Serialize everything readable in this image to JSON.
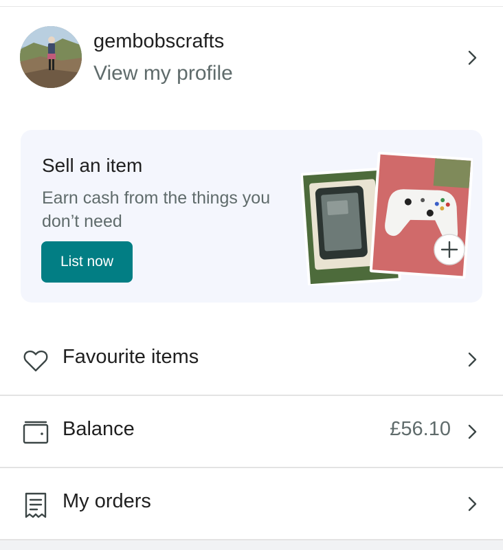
{
  "profile": {
    "username": "gembobscrafts",
    "link_label": "View my profile"
  },
  "sell_card": {
    "title": "Sell an item",
    "subtitle": "Earn cash from the things you don’t need",
    "button_label": "List now"
  },
  "menu": {
    "favourites": {
      "label": "Favourite items",
      "icon": "heart-icon"
    },
    "balance": {
      "label": "Balance",
      "value": "£56.10",
      "icon": "wallet-icon"
    },
    "orders": {
      "label": "My orders",
      "icon": "receipt-icon"
    }
  },
  "colors": {
    "accent": "#027e84",
    "card_background": "#f4f6fd",
    "secondary_text": "#5f6b6b"
  }
}
